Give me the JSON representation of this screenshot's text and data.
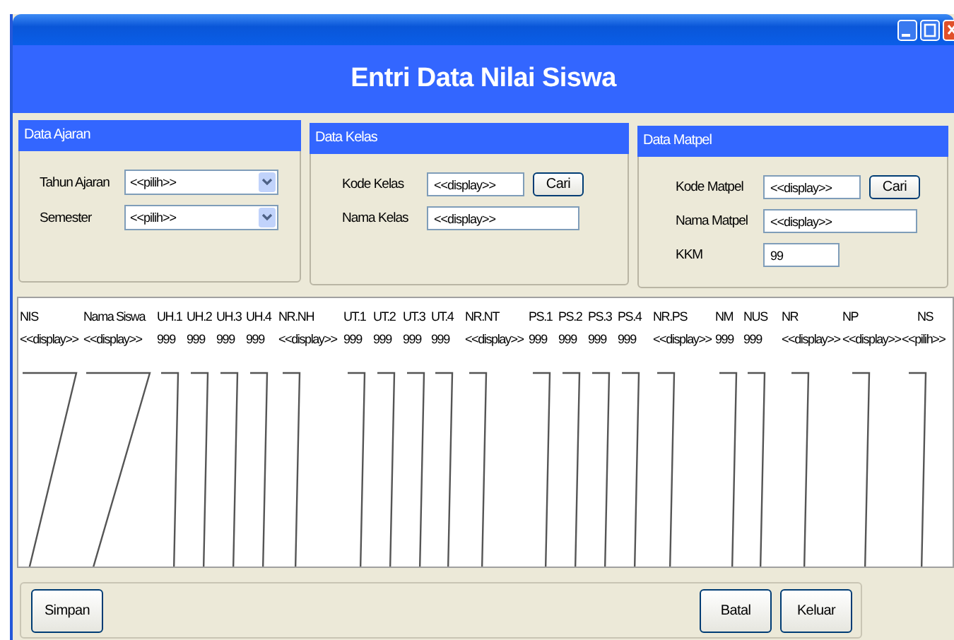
{
  "window": {
    "title": "Entri Data Nilai Siswa"
  },
  "panels": [
    {
      "title": "Data Ajaran",
      "fields": [
        {
          "label": "Tahun Ajaran",
          "kind": "dropdown",
          "value": "<<pilih>>"
        },
        {
          "label": "Semester",
          "kind": "dropdown",
          "value": "<<pilih>>"
        }
      ]
    },
    {
      "title": "Data Kelas",
      "fields": [
        {
          "label": "Kode Kelas",
          "kind": "text",
          "value": "<<display>>",
          "button": "Cari"
        },
        {
          "label": "Nama Kelas",
          "kind": "text",
          "value": "<<display>>"
        }
      ]
    },
    {
      "title": "Data Matpel",
      "fields": [
        {
          "label": "Kode Matpel",
          "kind": "text",
          "value": "<<display>>",
          "button": "Cari"
        },
        {
          "label": "Nama Matpel",
          "kind": "text",
          "value": "<<display>>"
        },
        {
          "label": "KKM",
          "kind": "text",
          "value": "99"
        }
      ]
    }
  ],
  "table": {
    "columns": [
      {
        "header": "NIS",
        "value": "<<display>>"
      },
      {
        "header": "Nama Siswa",
        "value": "<<display>>"
      },
      {
        "header": "UH.1",
        "value": "999"
      },
      {
        "header": "UH.2",
        "value": "999"
      },
      {
        "header": "UH.3",
        "value": "999"
      },
      {
        "header": "UH.4",
        "value": "999"
      },
      {
        "header": "NR.NH",
        "value": "<<display>>"
      },
      {
        "header": "UT.1",
        "value": "999"
      },
      {
        "header": "UT.2",
        "value": "999"
      },
      {
        "header": "UT.3",
        "value": "999"
      },
      {
        "header": "UT.4",
        "value": "999"
      },
      {
        "header": "NR.NT",
        "value": "<<display>>"
      },
      {
        "header": "PS.1",
        "value": "999"
      },
      {
        "header": "PS.2",
        "value": "999"
      },
      {
        "header": "PS.3",
        "value": "999"
      },
      {
        "header": "PS.4",
        "value": "999"
      },
      {
        "header": "NR.PS",
        "value": "<<display>>"
      },
      {
        "header": "NM",
        "value": "999"
      },
      {
        "header": "NUS",
        "value": "999"
      },
      {
        "header": "NR",
        "value": "<<display>>"
      },
      {
        "header": "NP",
        "value": "<<display>>"
      },
      {
        "header": "NS",
        "value": "<<pilih>>"
      }
    ]
  },
  "buttons_left": [
    "Simpan"
  ],
  "buttons_right": [
    "Batal",
    "Keluar"
  ]
}
